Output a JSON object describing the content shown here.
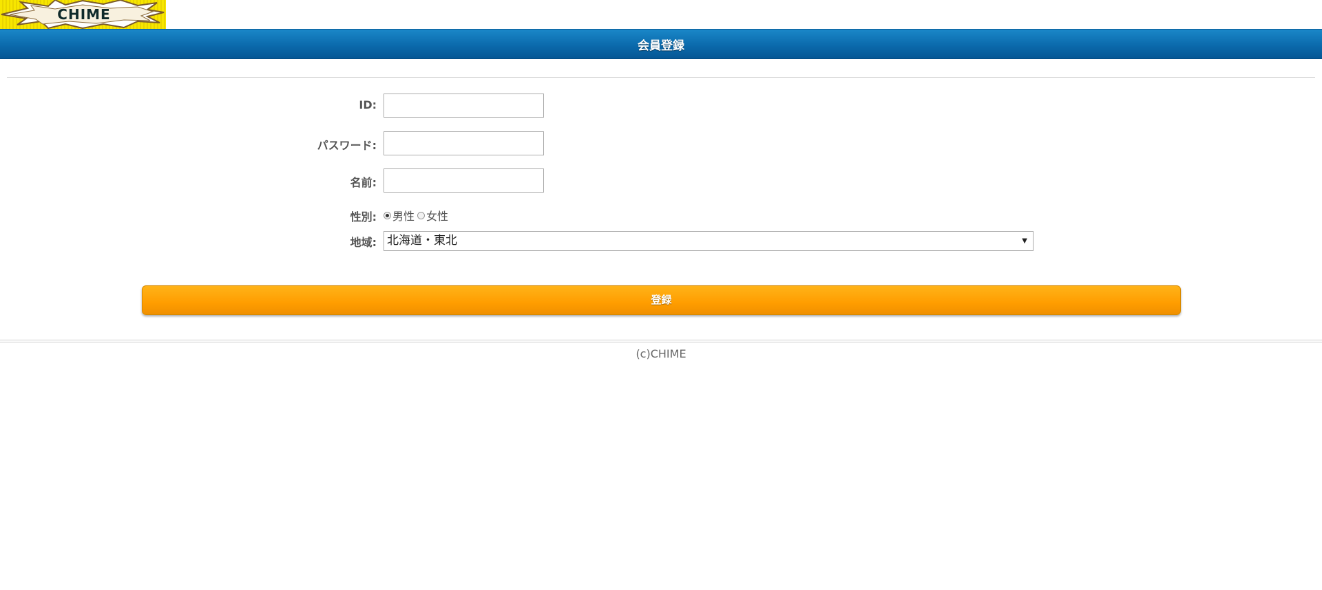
{
  "logo": {
    "text": "CHIME"
  },
  "header": {
    "title": "会員登録"
  },
  "form": {
    "id": {
      "label": "ID:",
      "value": ""
    },
    "password": {
      "label": "パスワード:",
      "value": ""
    },
    "name": {
      "label": "名前:",
      "value": ""
    },
    "gender": {
      "label": "性別:",
      "options": [
        {
          "label": "男性",
          "checked": true
        },
        {
          "label": "女性",
          "checked": false
        }
      ]
    },
    "region": {
      "label": "地域:",
      "selected": "北海道・東北"
    },
    "submit_label": "登録"
  },
  "footer": {
    "copyright": "(c)CHIME"
  },
  "colors": {
    "header_blue": "#0b6aac",
    "button_orange": "#ff9d00",
    "logo_yellow": "#f7e600"
  }
}
